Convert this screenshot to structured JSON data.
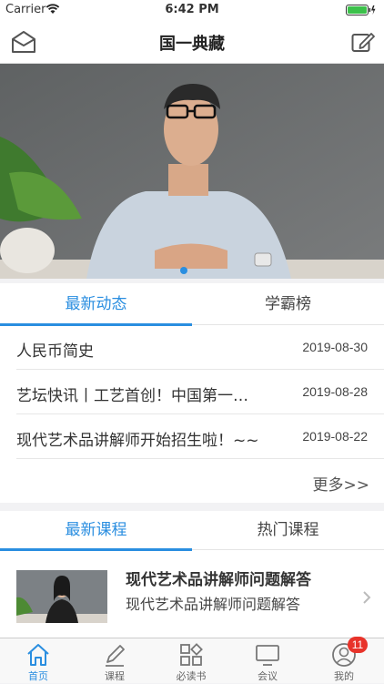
{
  "status_bar": {
    "carrier": "Carrier",
    "time": "6:42 PM"
  },
  "nav": {
    "title": "国一典藏",
    "left_icon": "mail-icon",
    "right_icon": "edit-icon"
  },
  "banner": {
    "pages": 1,
    "current_page": 1
  },
  "news": {
    "tabs": [
      {
        "label": "最新动态",
        "active": true
      },
      {
        "label": "学霸榜",
        "active": false
      }
    ],
    "items": [
      {
        "title": "人民币简史",
        "date": "2019-08-30"
      },
      {
        "title": "艺坛快讯丨工艺首创！中国第一…",
        "date": "2019-08-28"
      },
      {
        "title": "现代艺术品讲解师开始招生啦！~~",
        "date": "2019-08-22"
      }
    ],
    "more_label": "更多>>"
  },
  "courses": {
    "tabs": [
      {
        "label": "最新课程",
        "active": true
      },
      {
        "label": "热门课程",
        "active": false
      }
    ],
    "items": [
      {
        "title": "现代艺术品讲解师问题解答",
        "subtitle": "现代艺术品讲解师问题解答"
      }
    ]
  },
  "tabbar": {
    "items": [
      {
        "label": "首页",
        "icon": "home-icon",
        "active": true
      },
      {
        "label": "课程",
        "icon": "pencil-icon",
        "active": false
      },
      {
        "label": "必读书",
        "icon": "grid-icon",
        "active": false
      },
      {
        "label": "会议",
        "icon": "monitor-icon",
        "active": false
      },
      {
        "label": "我的",
        "icon": "profile-icon",
        "active": false,
        "badge": "11"
      }
    ]
  },
  "colors": {
    "accent": "#2a8ee0",
    "badge": "#e8332a"
  }
}
